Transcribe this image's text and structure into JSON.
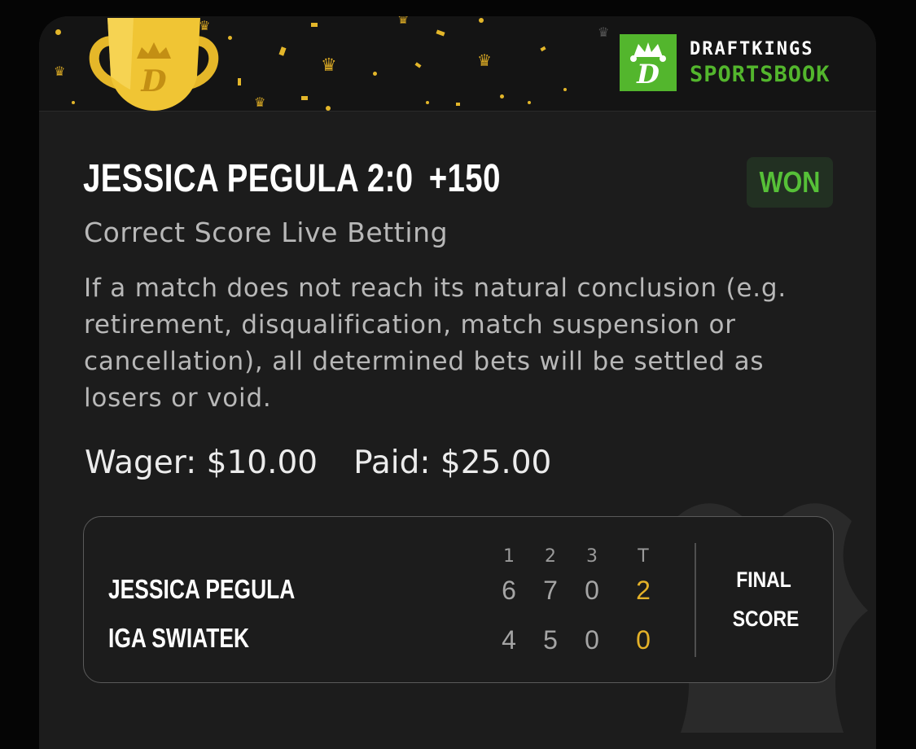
{
  "brand": {
    "line1": "DRAFTKINGS",
    "line2": "SPORTSBOOK",
    "logo_letter": "D",
    "green": "#53b62d"
  },
  "bet": {
    "selection": "JESSICA PEGULA 2:0",
    "odds": "+150",
    "status": "WON",
    "market": "Correct Score Live Betting",
    "rules": "If a match does not reach its natural conclusion (e.g. retirement, disqualification, match suspension or cancellation), all determined bets will be settled as losers or void.",
    "wager_label": "Wager:",
    "wager": "$10.00",
    "paid_label": "Paid:",
    "paid": "$25.00"
  },
  "scoreboard": {
    "headers": [
      "1",
      "2",
      "3",
      "T"
    ],
    "players": [
      {
        "name": "JESSICA PEGULA",
        "sets": [
          "6",
          "7",
          "0"
        ],
        "total": "2"
      },
      {
        "name": "IGA SWIATEK",
        "sets": [
          "4",
          "5",
          "0"
        ],
        "total": "0"
      }
    ],
    "status_line1": "FINAL",
    "status_line2": "SCORE"
  },
  "icons": {
    "trophy": "trophy-icon",
    "logo": "draftkings-crown-logo",
    "confetti": "confetti"
  },
  "colors": {
    "won_text": "#56c038",
    "total_score": "#e4b128",
    "confetti": "#e3b62a"
  }
}
